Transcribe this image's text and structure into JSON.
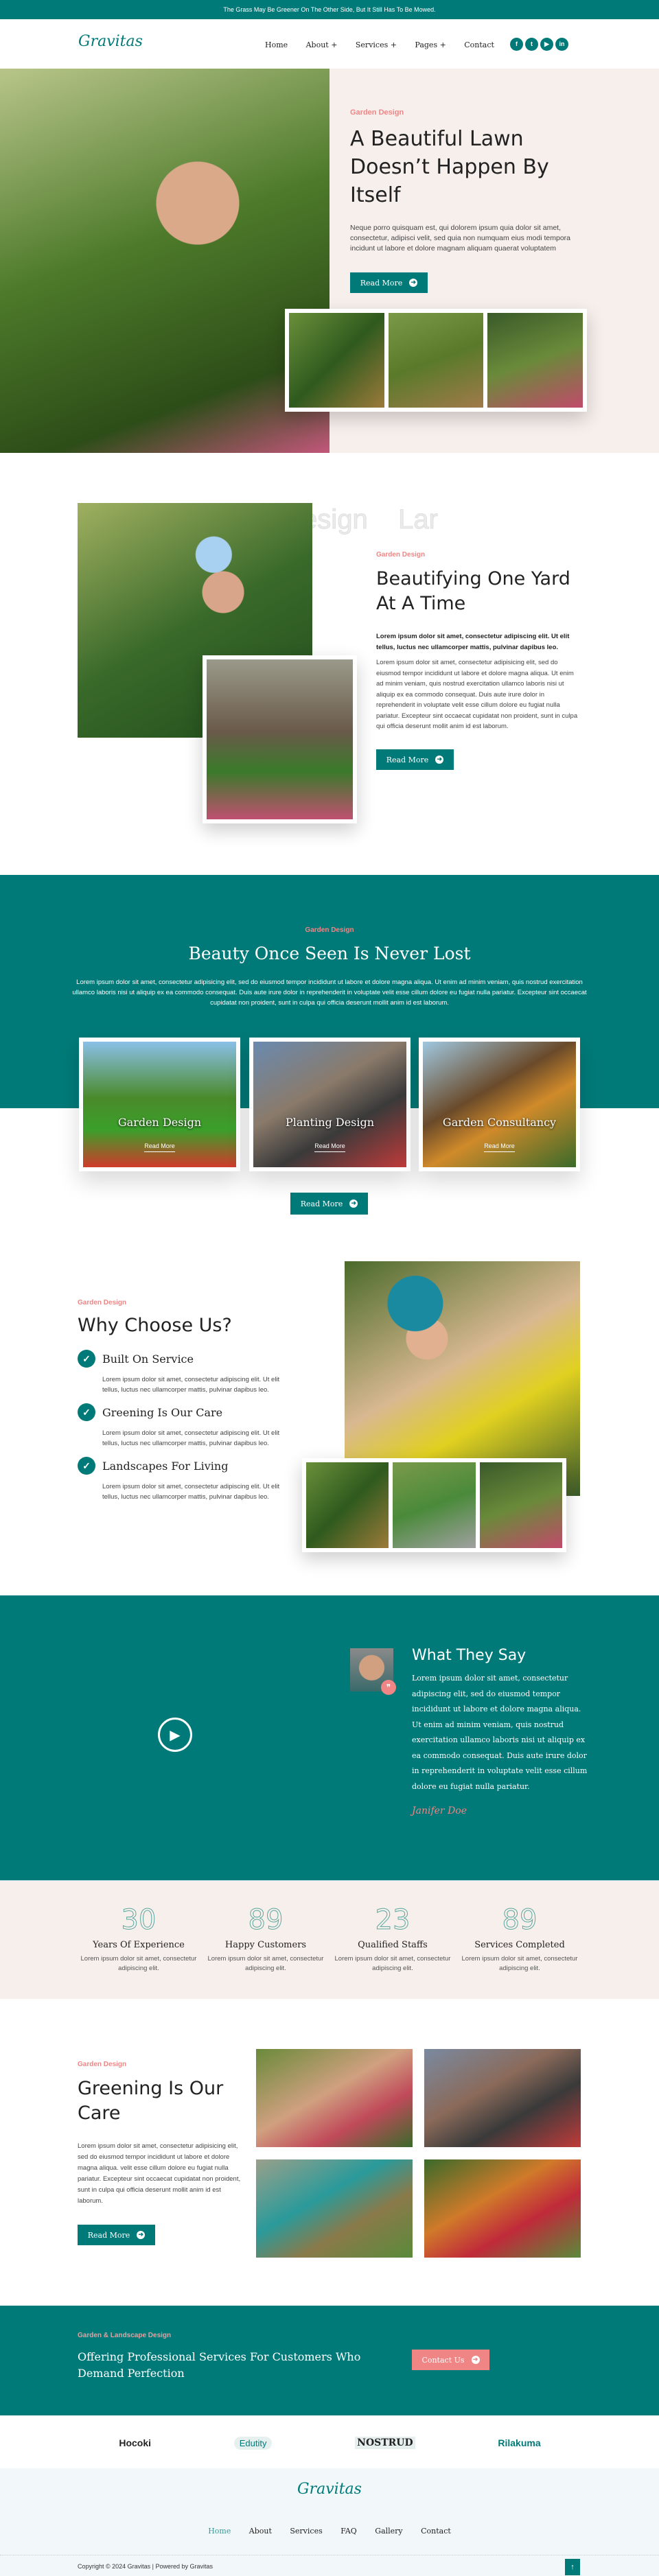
{
  "topbar": {
    "text": "The Grass May Be Greener On The Other Side, But It Still Has To Be Mowed."
  },
  "header": {
    "logo": "Gravitas",
    "nav": [
      {
        "label": "Home"
      },
      {
        "label": "About +"
      },
      {
        "label": "Services +"
      },
      {
        "label": "Pages +"
      },
      {
        "label": "Contact"
      }
    ],
    "social": [
      "facebook-icon",
      "twitter-icon",
      "youtube-icon",
      "linkedin-icon"
    ]
  },
  "hero": {
    "tag": "Garden Design",
    "title": "A Beautiful Lawn Doesn’t Happen By Itself",
    "text": "Neque porro quisquam est, qui dolorem ipsum quia dolor sit amet, consectetur, adipisci velit, sed quia non numquam eius modi tempora incidunt ut labore et dolore magnam aliquam quaerat voluptatem",
    "button": "Read More"
  },
  "about": {
    "watermark": "rden Design    Lar",
    "tag": "Garden Design",
    "title": "Beautifying One Yard At A Time",
    "lead": "Lorem ipsum dolor sit amet, consectetur adipiscing elit. Ut elit tellus, luctus nec ullamcorper mattis, pulvinar dapibus leo.",
    "text": "Lorem ipsum dolor sit amet, consectetur adipisicing elit, sed do eiusmod tempor incididunt ut labore et dolore magna aliqua. Ut enim ad minim veniam, quis nostrud exercitation ullamco laboris nisi ut aliquip ex ea commodo consequat. Duis aute irure dolor in reprehenderit in voluptate velit esse cillum dolore eu fugiat nulla pariatur. Excepteur sint occaecat cupidatat non proident, sunt in culpa qui officia deserunt mollit anim id est laborum.",
    "button": "Read More"
  },
  "services": {
    "tag": "Garden Design",
    "title": "Beauty Once Seen Is Never Lost",
    "text": "Lorem ipsum dolor sit amet, consectetur adipisicing elit, sed do eiusmod tempor incididunt ut labore et dolore magna aliqua. Ut enim ad minim veniam, quis nostrud exercitation ullamco laboris nisi ut aliquip ex ea commodo consequat. Duis aute irure dolor in reprehenderit in voluptate velit esse cillum dolore eu fugiat nulla pariatur. Excepteur sint occaecat cupidatat non proident, sunt in culpa qui officia deserunt mollit anim id est laborum.",
    "cards": [
      {
        "title": "Garden Design",
        "link": "Read More"
      },
      {
        "title": "Planting Design",
        "link": "Read More"
      },
      {
        "title": "Garden Consultancy",
        "link": "Read More"
      }
    ],
    "button": "Read More"
  },
  "why": {
    "tag": "Garden Design",
    "title": "Why Choose Us?",
    "items": [
      {
        "title": "Built On Service",
        "text": "Lorem ipsum dolor sit amet, consectetur adipiscing elit. Ut elit tellus, luctus nec ullamcorper mattis, pulvinar dapibus leo."
      },
      {
        "title": "Greening Is Our Care",
        "text": "Lorem ipsum dolor sit amet, consectetur adipiscing elit. Ut elit tellus, luctus nec ullamcorper mattis, pulvinar dapibus leo."
      },
      {
        "title": "Landscapes For Living",
        "text": "Lorem ipsum dolor sit amet, consectetur adipiscing elit. Ut elit tellus, luctus nec ullamcorper mattis, pulvinar dapibus leo."
      }
    ]
  },
  "testimonial": {
    "title": "What They Say",
    "text": "Lorem ipsum dolor sit amet, consectetur adipiscing elit, sed do eiusmod tempor incididunt ut labore et dolore magna aliqua. Ut enim ad minim veniam, quis nostrud exercitation ullamco laboris nisi ut aliquip ex ea commodo consequat. Duis aute irure dolor in reprehenderit in voluptate velit esse cillum dolore eu fugiat nulla pariatur.",
    "signature": "Janifer Doe"
  },
  "stats": [
    {
      "num": "30",
      "title": "Years Of Experience",
      "text": "Lorem ipsum dolor sit amet, consectetur adipiscing elit."
    },
    {
      "num": "89",
      "title": "Happy Customers",
      "text": "Lorem ipsum dolor sit amet, consectetur adipiscing elit."
    },
    {
      "num": "23",
      "title": "Qualified Staffs",
      "text": "Lorem ipsum dolor sit amet, consectetur adipiscing elit."
    },
    {
      "num": "89",
      "title": "Services Completed",
      "text": "Lorem ipsum dolor sit amet, consectetur adipiscing elit."
    }
  ],
  "greening": {
    "tag": "Garden Design",
    "title": "Greening Is Our Care",
    "text": "Lorem ipsum dolor sit amet, consectetur adipisicing elit, sed do eiusmod tempor incididunt ut labore et dolore magna aliqua.  velit esse cillum dolore eu fugiat nulla pariatur. Excepteur sint occaecat cupidatat non proident, sunt in culpa qui officia deserunt mollit anim id est laborum.",
    "button": "Read More"
  },
  "cta": {
    "tag": "Garden & Landscape Design",
    "title": "Offering Professional Services For Customers Who Demand Perfection",
    "button": "Contact Us"
  },
  "partners": [
    "Hocoki",
    "Edutity",
    "NOSTRUD",
    "Rilakuma"
  ],
  "footer": {
    "logo": "Gravitas",
    "nav": [
      {
        "label": "Home"
      },
      {
        "label": "About"
      },
      {
        "label": "Services"
      },
      {
        "label": "FAQ"
      },
      {
        "label": "Gallery"
      },
      {
        "label": "Contact"
      }
    ],
    "copyright": "Copyright © 2024 Gravitas | Powered by Gravitas"
  },
  "colors": {
    "teal": "#007a78",
    "pink": "#ef8585",
    "cream": "#f7efec"
  }
}
